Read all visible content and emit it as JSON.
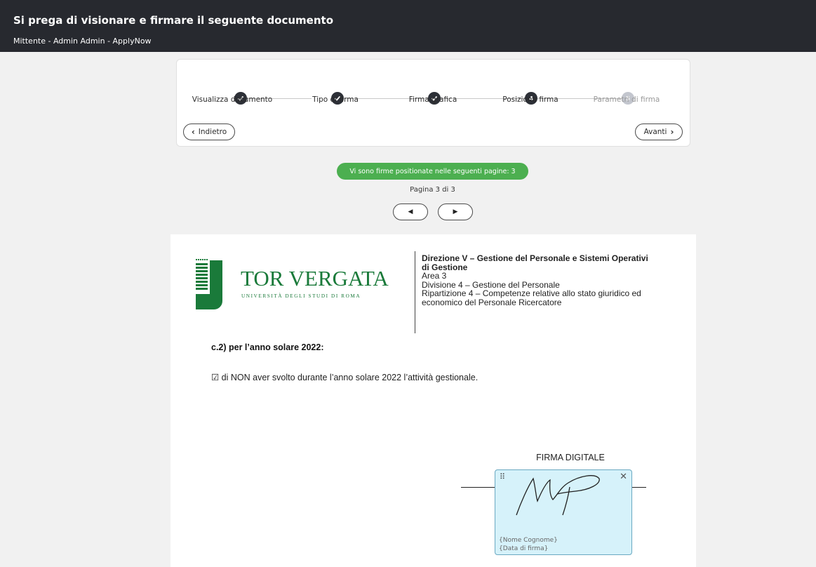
{
  "header": {
    "title": "Si prega di visionare e firmare il seguente documento",
    "subtitle": "Mittente - Admin Admin - ApplyNow"
  },
  "stepper": {
    "steps": [
      {
        "label": "Visualizza documento",
        "state": "done"
      },
      {
        "label": "Tipo di firma",
        "state": "done"
      },
      {
        "label": "Firma grafica",
        "state": "done"
      },
      {
        "label": "Posiziona firma",
        "state": "current",
        "number": "4"
      },
      {
        "label": "Parametri di firma",
        "state": "disabled",
        "number": "5"
      }
    ],
    "back_label": "Indietro",
    "next_label": "Avanti"
  },
  "badge": {
    "text": "Vi sono firme positionate nelle seguenti pagine: 3",
    "color": "#4caf50"
  },
  "pagination": {
    "text": "Pagina 3 di 3",
    "prev_icon": "caret-left-icon",
    "next_icon": "caret-right-icon"
  },
  "document": {
    "logo": {
      "name": "TOR VERGATA",
      "tagline": "UNIVERSITÀ DEGLI STUDI DI ROMA",
      "color": "#1a7a3a"
    },
    "dept": {
      "line1": "Direzione V – Gestione del Personale e Sistemi Operativi",
      "line2": "di Gestione",
      "line3": "Area 3",
      "line4": "Divisione 4 – Gestione del Personale",
      "line5": "Ripartizione 4 – Competenze relative allo stato giuridico ed",
      "line6": "economico del Personale Ricercatore"
    },
    "section_title": "c.2) per l’anno solare 2022:",
    "statement": "☑ di NON aver svolto durante l’anno solare 2022 l’attività gestionale.",
    "firma_label": "FIRMA DIGITALE"
  },
  "signature": {
    "name_placeholder": "{Nome Cognome}",
    "date_placeholder": "{Data di firma}",
    "handle_icon": "drag-handle-icon",
    "close_icon": "close-icon",
    "box_color": "#d6f2fa"
  }
}
